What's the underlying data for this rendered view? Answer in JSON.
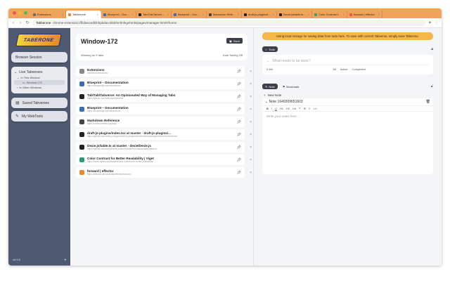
{
  "browser": {
    "tabs": [
      {
        "label": "Extensions",
        "color": "#6d6d6d",
        "active": false
      },
      {
        "label": "Tabberone",
        "color": "#e8892b",
        "active": true
      },
      {
        "label": "Blueprint – Documentation",
        "color": "#3b6cb5",
        "active": false
      },
      {
        "label": "Tab/Tab/Tabverse: An Opi...",
        "color": "#222222",
        "active": false
      },
      {
        "label": "Blueprint – Documentation",
        "color": "#3b6cb5",
        "active": false
      },
      {
        "label": "Markdown Reference",
        "color": "#444444",
        "active": false
      },
      {
        "label": "draft-js-plugins/index.tsx at...",
        "color": "#222222",
        "active": false
      },
      {
        "label": "Dexie.js/table.ts at master",
        "color": "#222222",
        "active": false
      },
      {
        "label": "Color Contrast for Better Re...",
        "color": "#2a7",
        "active": false
      },
      {
        "label": "forward | effector",
        "color": "#e55",
        "active": false
      }
    ],
    "url_scheme": "Tabberone",
    "url": "chrome-extension://fbdaeoedkfnhpbdacobbbfnnfmfegnhmbi/pages/manager.html#/home"
  },
  "sidebar": {
    "logo_text": "TABERONE",
    "browser_session": "Browser Session",
    "live_tabverses": "Live Tabverses",
    "in_this_window": "In This Window",
    "window_name": "Window-172",
    "in_other_windows": "In Other Windows",
    "saved_tabverses": "Saved Tabverses",
    "my_webtools": "My WebTools",
    "version": "v0.9.0",
    "footer_icon": "heart-icon"
  },
  "main": {
    "window_title": "Window-172",
    "save_label": "Save",
    "working_on": "Working on 9 tabs",
    "auto_saving": "Auto Saving Off",
    "tabs": [
      {
        "title": "Extensions",
        "url": "chrome://extensions/",
        "color": "#8a8a8a"
      },
      {
        "title": "Blueprint – Documentation",
        "url": "https://blueprintjs.com/docs/#core",
        "color": "#3b6cb5"
      },
      {
        "title": "Tab/Tab/Tabverse: An Opinionated Way of Managing Tabs",
        "url": "https://github.com/tabverse/tabverse",
        "color": "#222222"
      },
      {
        "title": "Blueprint – Documentation",
        "url": "https://blueprintjs.com/docs/#core",
        "color": "#3b6cb5"
      },
      {
        "title": "Markdown Reference",
        "url": "https://commonmark.org/help/",
        "color": "#444444"
      },
      {
        "title": "draft-js-plugins/index.tsx at master · draft-js-plugins/...",
        "url": "https://github.com/draft-js-plugins/draft-js-plugins/blob/master/packages/editor/src/index.tsx",
        "color": "#222222"
      },
      {
        "title": "Dexie.js/table.ts at master · dexie/Dexie.js",
        "url": "https://github.com/dexie/Dexie.js/blob/master/src/classes/table/table.ts",
        "color": "#222222"
      },
      {
        "title": "Color Contrast for Better Readability | Viget",
        "url": "https://www.vigets.com/articles/color-contrast-for-better-readability/",
        "color": "#2aa06f"
      },
      {
        "title": "forward | effector",
        "url": "https://effector.dev/docs/api/effector/forward",
        "color": "#e8892b"
      }
    ]
  },
  "right": {
    "banner": "Using local storage for saving data from todo here. To save with current Tabverse, simply save Tabverse.",
    "todo_chip": "Todo",
    "todo_placeholder": "What needs to be done?",
    "todo_count": "0 left",
    "filter_all": "All",
    "filter_active": "Active",
    "filter_completed": "Completed",
    "note_chip": "Note",
    "bookmark_chip": "Bookmark",
    "new_note": "New Note",
    "note_title": "Note 1649309651603",
    "note_placeholder": "Write your notes here ..."
  }
}
